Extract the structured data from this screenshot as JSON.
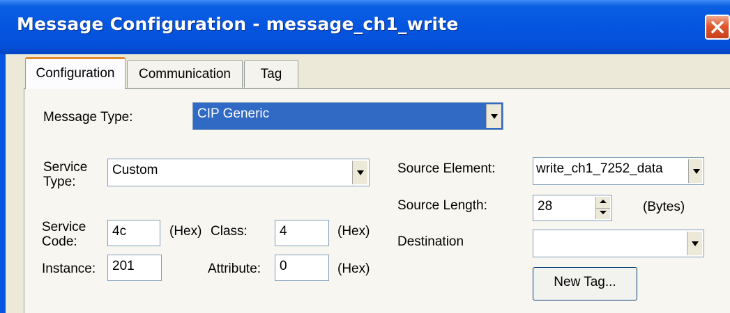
{
  "window": {
    "title": "Message Configuration - message_ch1_write",
    "close_icon": "close-icon"
  },
  "tabs": [
    {
      "label": "Configuration",
      "active": true
    },
    {
      "label": "Communication",
      "active": false
    },
    {
      "label": "Tag",
      "active": false
    }
  ],
  "config": {
    "message_type_label": "Message Type:",
    "message_type_value": "CIP Generic",
    "service_type_label": "Service Type:",
    "service_type_value": "Custom",
    "service_code_label": "Service Code:",
    "service_code_value": "4c",
    "service_code_unit": "(Hex)",
    "class_label": "Class:",
    "class_value": "4",
    "class_unit": "(Hex)",
    "instance_label": "Instance:",
    "instance_value": "201",
    "attribute_label": "Attribute:",
    "attribute_value": "0",
    "attribute_unit": "(Hex)",
    "source_element_label": "Source Element:",
    "source_element_value": "write_ch1_7252_data",
    "source_length_label": "Source Length:",
    "source_length_value": "28",
    "source_length_unit": "(Bytes)",
    "destination_label": "Destination",
    "destination_value": "",
    "new_tag_label": "New Tag..."
  }
}
